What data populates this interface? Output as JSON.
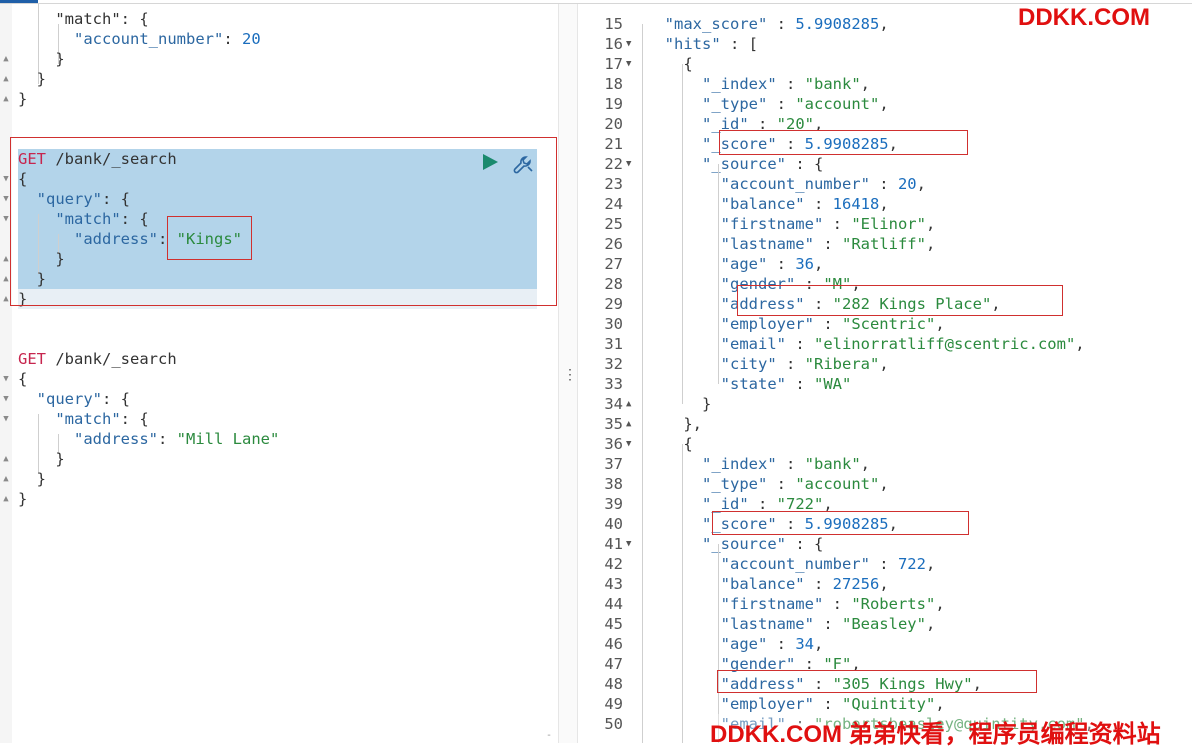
{
  "left_editor": {
    "lines": [
      {
        "id": "l1",
        "parts": [
          [
            "p",
            "    \"match\": {"
          ]
        ]
      },
      {
        "id": "l2",
        "parts": [
          [
            "p",
            "      "
          ],
          [
            "k",
            "\"account_number\""
          ],
          [
            "p",
            ": "
          ],
          [
            "n",
            "20"
          ]
        ]
      },
      {
        "id": "l3",
        "parts": [
          [
            "p",
            "    }"
          ]
        ]
      },
      {
        "id": "l4",
        "parts": [
          [
            "p",
            "  }"
          ]
        ]
      },
      {
        "id": "l5",
        "parts": [
          [
            "p",
            "}"
          ]
        ]
      },
      {
        "id": "q1_method",
        "parts": [
          [
            "m",
            "GET"
          ],
          [
            "p",
            " /bank/_search"
          ]
        ]
      },
      {
        "id": "q1_l1",
        "parts": [
          [
            "p",
            "{"
          ]
        ]
      },
      {
        "id": "q1_l2",
        "parts": [
          [
            "p",
            "  "
          ],
          [
            "k",
            "\"query\""
          ],
          [
            "p",
            ": {"
          ]
        ]
      },
      {
        "id": "q1_l3",
        "parts": [
          [
            "p",
            "    "
          ],
          [
            "k",
            "\"match\""
          ],
          [
            "p",
            ": {"
          ]
        ]
      },
      {
        "id": "q1_l4",
        "parts": [
          [
            "p",
            "      "
          ],
          [
            "k",
            "\"address\""
          ],
          [
            "p",
            ": "
          ],
          [
            "s",
            "\"Kings\""
          ]
        ]
      },
      {
        "id": "q1_l5",
        "parts": [
          [
            "p",
            "    }"
          ]
        ]
      },
      {
        "id": "q1_l6",
        "parts": [
          [
            "p",
            "  }"
          ]
        ]
      },
      {
        "id": "q1_l7",
        "parts": [
          [
            "p",
            "}"
          ]
        ]
      },
      {
        "id": "q2_method",
        "parts": [
          [
            "m",
            "GET"
          ],
          [
            "p",
            " /bank/_search"
          ]
        ]
      },
      {
        "id": "q2_l1",
        "parts": [
          [
            "p",
            "{"
          ]
        ]
      },
      {
        "id": "q2_l2",
        "parts": [
          [
            "p",
            "  "
          ],
          [
            "k",
            "\"query\""
          ],
          [
            "p",
            ": {"
          ]
        ]
      },
      {
        "id": "q2_l3",
        "parts": [
          [
            "p",
            "    "
          ],
          [
            "k",
            "\"match\""
          ],
          [
            "p",
            ": {"
          ]
        ]
      },
      {
        "id": "q2_l4",
        "parts": [
          [
            "p",
            "      "
          ],
          [
            "k",
            "\"address\""
          ],
          [
            "p",
            ": "
          ],
          [
            "s",
            "\"Mill Lane\""
          ]
        ]
      },
      {
        "id": "q2_l5",
        "parts": [
          [
            "p",
            "    }"
          ]
        ]
      },
      {
        "id": "q2_l6",
        "parts": [
          [
            "p",
            "  }"
          ]
        ]
      },
      {
        "id": "q2_l7",
        "parts": [
          [
            "p",
            "}"
          ]
        ]
      }
    ]
  },
  "right_output": {
    "lines": [
      {
        "n": "15",
        "fold": false,
        "t": [
          [
            "p",
            "  "
          ],
          [
            "k",
            "\"max_score\""
          ],
          [
            "p",
            " : "
          ],
          [
            "n",
            "5.9908285"
          ],
          [
            "p",
            ","
          ]
        ]
      },
      {
        "n": "16",
        "fold": true,
        "t": [
          [
            "p",
            "  "
          ],
          [
            "k",
            "\"hits\""
          ],
          [
            "p",
            " : ["
          ]
        ]
      },
      {
        "n": "17",
        "fold": true,
        "t": [
          [
            "p",
            "    {"
          ]
        ]
      },
      {
        "n": "18",
        "fold": false,
        "t": [
          [
            "p",
            "      "
          ],
          [
            "k",
            "\"_index\""
          ],
          [
            "p",
            " : "
          ],
          [
            "s",
            "\"bank\""
          ],
          [
            "p",
            ","
          ]
        ]
      },
      {
        "n": "19",
        "fold": false,
        "t": [
          [
            "p",
            "      "
          ],
          [
            "k",
            "\"_type\""
          ],
          [
            "p",
            " : "
          ],
          [
            "s",
            "\"account\""
          ],
          [
            "p",
            ","
          ]
        ]
      },
      {
        "n": "20",
        "fold": false,
        "t": [
          [
            "p",
            "      "
          ],
          [
            "k",
            "\"_id\""
          ],
          [
            "p",
            " : "
          ],
          [
            "s",
            "\"20\""
          ],
          [
            "p",
            ","
          ]
        ]
      },
      {
        "n": "21",
        "fold": false,
        "t": [
          [
            "p",
            "      "
          ],
          [
            "k",
            "\"_score\""
          ],
          [
            "p",
            " : "
          ],
          [
            "n",
            "5.9908285"
          ],
          [
            "p",
            ","
          ]
        ]
      },
      {
        "n": "22",
        "fold": true,
        "t": [
          [
            "p",
            "      "
          ],
          [
            "k",
            "\"_source\""
          ],
          [
            "p",
            " : {"
          ]
        ]
      },
      {
        "n": "23",
        "fold": false,
        "t": [
          [
            "p",
            "        "
          ],
          [
            "k",
            "\"account_number\""
          ],
          [
            "p",
            " : "
          ],
          [
            "n",
            "20"
          ],
          [
            "p",
            ","
          ]
        ]
      },
      {
        "n": "24",
        "fold": false,
        "t": [
          [
            "p",
            "        "
          ],
          [
            "k",
            "\"balance\""
          ],
          [
            "p",
            " : "
          ],
          [
            "n",
            "16418"
          ],
          [
            "p",
            ","
          ]
        ]
      },
      {
        "n": "25",
        "fold": false,
        "t": [
          [
            "p",
            "        "
          ],
          [
            "k",
            "\"firstname\""
          ],
          [
            "p",
            " : "
          ],
          [
            "s",
            "\"Elinor\""
          ],
          [
            "p",
            ","
          ]
        ]
      },
      {
        "n": "26",
        "fold": false,
        "t": [
          [
            "p",
            "        "
          ],
          [
            "k",
            "\"lastname\""
          ],
          [
            "p",
            " : "
          ],
          [
            "s",
            "\"Ratliff\""
          ],
          [
            "p",
            ","
          ]
        ]
      },
      {
        "n": "27",
        "fold": false,
        "t": [
          [
            "p",
            "        "
          ],
          [
            "k",
            "\"age\""
          ],
          [
            "p",
            " : "
          ],
          [
            "n",
            "36"
          ],
          [
            "p",
            ","
          ]
        ]
      },
      {
        "n": "28",
        "fold": false,
        "t": [
          [
            "p",
            "        "
          ],
          [
            "k",
            "\"gender\""
          ],
          [
            "p",
            " : "
          ],
          [
            "s",
            "\"M\""
          ],
          [
            "p",
            ","
          ]
        ]
      },
      {
        "n": "29",
        "fold": false,
        "t": [
          [
            "p",
            "        "
          ],
          [
            "k",
            "\"address\""
          ],
          [
            "p",
            " : "
          ],
          [
            "s",
            "\"282 Kings Place\""
          ],
          [
            "p",
            ","
          ]
        ]
      },
      {
        "n": "30",
        "fold": false,
        "t": [
          [
            "p",
            "        "
          ],
          [
            "k",
            "\"employer\""
          ],
          [
            "p",
            " : "
          ],
          [
            "s",
            "\"Scentric\""
          ],
          [
            "p",
            ","
          ]
        ]
      },
      {
        "n": "31",
        "fold": false,
        "t": [
          [
            "p",
            "        "
          ],
          [
            "k",
            "\"email\""
          ],
          [
            "p",
            " : "
          ],
          [
            "s",
            "\"elinorratliff@scentric.com\""
          ],
          [
            "p",
            ","
          ]
        ]
      },
      {
        "n": "32",
        "fold": false,
        "t": [
          [
            "p",
            "        "
          ],
          [
            "k",
            "\"city\""
          ],
          [
            "p",
            " : "
          ],
          [
            "s",
            "\"Ribera\""
          ],
          [
            "p",
            ","
          ]
        ]
      },
      {
        "n": "33",
        "fold": false,
        "t": [
          [
            "p",
            "        "
          ],
          [
            "k",
            "\"state\""
          ],
          [
            "p",
            " : "
          ],
          [
            "s",
            "\"WA\""
          ]
        ]
      },
      {
        "n": "34",
        "fold": true,
        "t": [
          [
            "p",
            "      }"
          ]
        ]
      },
      {
        "n": "35",
        "fold": true,
        "t": [
          [
            "p",
            "    },"
          ]
        ]
      },
      {
        "n": "36",
        "fold": true,
        "t": [
          [
            "p",
            "    {"
          ]
        ]
      },
      {
        "n": "37",
        "fold": false,
        "t": [
          [
            "p",
            "      "
          ],
          [
            "k",
            "\"_index\""
          ],
          [
            "p",
            " : "
          ],
          [
            "s",
            "\"bank\""
          ],
          [
            "p",
            ","
          ]
        ]
      },
      {
        "n": "38",
        "fold": false,
        "t": [
          [
            "p",
            "      "
          ],
          [
            "k",
            "\"_type\""
          ],
          [
            "p",
            " : "
          ],
          [
            "s",
            "\"account\""
          ],
          [
            "p",
            ","
          ]
        ]
      },
      {
        "n": "39",
        "fold": false,
        "t": [
          [
            "p",
            "      "
          ],
          [
            "k",
            "\"_id\""
          ],
          [
            "p",
            " : "
          ],
          [
            "s",
            "\"722\""
          ],
          [
            "p",
            ","
          ]
        ]
      },
      {
        "n": "40",
        "fold": false,
        "t": [
          [
            "p",
            "      "
          ],
          [
            "k",
            "\"_score\""
          ],
          [
            "p",
            " : "
          ],
          [
            "n",
            "5.9908285"
          ],
          [
            "p",
            ","
          ]
        ]
      },
      {
        "n": "41",
        "fold": true,
        "t": [
          [
            "p",
            "      "
          ],
          [
            "k",
            "\"_source\""
          ],
          [
            "p",
            " : {"
          ]
        ]
      },
      {
        "n": "42",
        "fold": false,
        "t": [
          [
            "p",
            "        "
          ],
          [
            "k",
            "\"account_number\""
          ],
          [
            "p",
            " : "
          ],
          [
            "n",
            "722"
          ],
          [
            "p",
            ","
          ]
        ]
      },
      {
        "n": "43",
        "fold": false,
        "t": [
          [
            "p",
            "        "
          ],
          [
            "k",
            "\"balance\""
          ],
          [
            "p",
            " : "
          ],
          [
            "n",
            "27256"
          ],
          [
            "p",
            ","
          ]
        ]
      },
      {
        "n": "44",
        "fold": false,
        "t": [
          [
            "p",
            "        "
          ],
          [
            "k",
            "\"firstname\""
          ],
          [
            "p",
            " : "
          ],
          [
            "s",
            "\"Roberts\""
          ],
          [
            "p",
            ","
          ]
        ]
      },
      {
        "n": "45",
        "fold": false,
        "t": [
          [
            "p",
            "        "
          ],
          [
            "k",
            "\"lastname\""
          ],
          [
            "p",
            " : "
          ],
          [
            "s",
            "\"Beasley\""
          ],
          [
            "p",
            ","
          ]
        ]
      },
      {
        "n": "46",
        "fold": false,
        "t": [
          [
            "p",
            "        "
          ],
          [
            "k",
            "\"age\""
          ],
          [
            "p",
            " : "
          ],
          [
            "n",
            "34"
          ],
          [
            "p",
            ","
          ]
        ]
      },
      {
        "n": "47",
        "fold": false,
        "t": [
          [
            "p",
            "        "
          ],
          [
            "k",
            "\"gender\""
          ],
          [
            "p",
            " : "
          ],
          [
            "s",
            "\"F\""
          ],
          [
            "p",
            ","
          ]
        ]
      },
      {
        "n": "48",
        "fold": false,
        "t": [
          [
            "p",
            "        "
          ],
          [
            "k",
            "\"address\""
          ],
          [
            "p",
            " : "
          ],
          [
            "s",
            "\"305 Kings Hwy\""
          ],
          [
            "p",
            ","
          ]
        ]
      },
      {
        "n": "49",
        "fold": false,
        "t": [
          [
            "p",
            "        "
          ],
          [
            "k",
            "\"employer\""
          ],
          [
            "p",
            " : "
          ],
          [
            "s",
            "\"Quintity\""
          ],
          [
            "p",
            ","
          ]
        ]
      },
      {
        "n": "50",
        "fold": false,
        "t": [
          [
            "p",
            "        "
          ],
          [
            "k",
            "\"email\""
          ],
          [
            "p",
            " : "
          ],
          [
            "s",
            "\"robertsbeasley@quintity.com\""
          ],
          [
            "p",
            ","
          ]
        ]
      }
    ]
  },
  "watermark_top": "DDKK.COM",
  "watermark_bottom": "DDKK.COM 弟弟快看，程序员编程资料站",
  "colors": {
    "accent": "#1f5fa8",
    "highlight": "#b3d4ea",
    "annotation_box": "#d0302f",
    "play": "#1a8a6e"
  },
  "icons": {
    "run": "play-icon",
    "settings": "wrench-icon"
  }
}
